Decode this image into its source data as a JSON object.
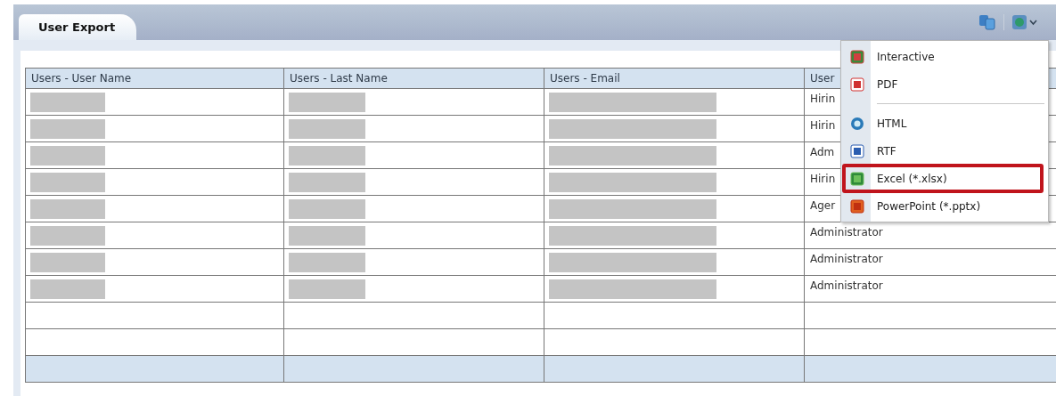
{
  "tab": {
    "label": "User Export",
    "selected": true
  },
  "table": {
    "columns": [
      "Users - User Name",
      "Users - Last Name",
      "Users - Email",
      "User"
    ],
    "rows": [
      {
        "kind": "data",
        "cells": [
          {
            "kind": "redacted"
          },
          {
            "kind": "redacted"
          },
          {
            "kind": "redacted"
          },
          {
            "kind": "text",
            "text": "Hirin"
          }
        ]
      },
      {
        "kind": "data",
        "cells": [
          {
            "kind": "redacted"
          },
          {
            "kind": "redacted"
          },
          {
            "kind": "redacted"
          },
          {
            "kind": "text",
            "text": "Hirin"
          }
        ]
      },
      {
        "kind": "data",
        "cells": [
          {
            "kind": "redacted"
          },
          {
            "kind": "redacted"
          },
          {
            "kind": "redacted"
          },
          {
            "kind": "text",
            "text": "Adm"
          }
        ]
      },
      {
        "kind": "data",
        "cells": [
          {
            "kind": "redacted"
          },
          {
            "kind": "redacted"
          },
          {
            "kind": "redacted"
          },
          {
            "kind": "text",
            "text": "Hirin"
          }
        ]
      },
      {
        "kind": "data",
        "cells": [
          {
            "kind": "redacted"
          },
          {
            "kind": "redacted"
          },
          {
            "kind": "redacted"
          },
          {
            "kind": "text",
            "text": "Ager"
          }
        ]
      },
      {
        "kind": "data",
        "cells": [
          {
            "kind": "redacted"
          },
          {
            "kind": "redacted"
          },
          {
            "kind": "redacted"
          },
          {
            "kind": "text",
            "text": "Administrator"
          }
        ]
      },
      {
        "kind": "data",
        "cells": [
          {
            "kind": "redacted"
          },
          {
            "kind": "redacted"
          },
          {
            "kind": "redacted"
          },
          {
            "kind": "text",
            "text": "Administrator"
          }
        ]
      },
      {
        "kind": "data",
        "cells": [
          {
            "kind": "redacted"
          },
          {
            "kind": "redacted"
          },
          {
            "kind": "redacted"
          },
          {
            "kind": "text",
            "text": "Administrator"
          }
        ]
      },
      {
        "kind": "blank"
      },
      {
        "kind": "blank"
      },
      {
        "kind": "footer"
      }
    ]
  },
  "export_menu": {
    "items": [
      {
        "kind": "interactive",
        "label": "Interactive",
        "highlighted": false
      },
      {
        "kind": "pdf",
        "label": "PDF",
        "highlighted": false
      },
      {
        "kind": "separator"
      },
      {
        "kind": "html",
        "label": "HTML",
        "highlighted": false
      },
      {
        "kind": "rtf",
        "label": "RTF",
        "highlighted": false
      },
      {
        "kind": "excel",
        "label": "Excel (*.xlsx)",
        "highlighted": true
      },
      {
        "kind": "powerpoint",
        "label": "PowerPoint (*.pptx)",
        "highlighted": false
      }
    ]
  }
}
